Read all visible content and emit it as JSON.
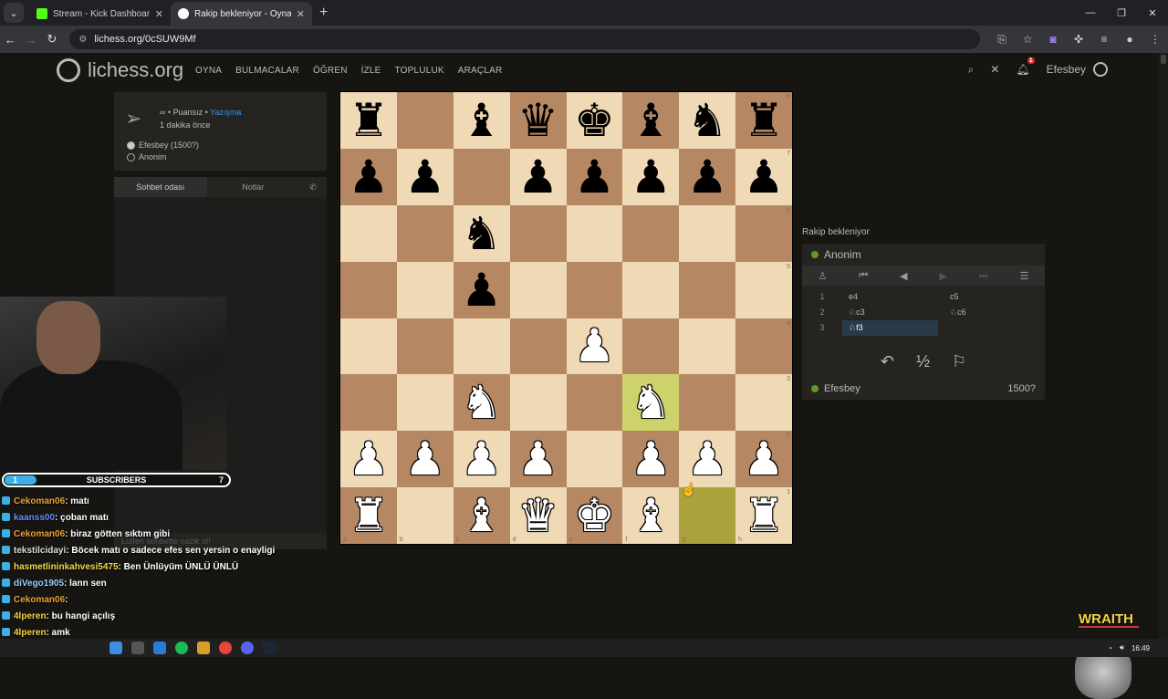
{
  "browser": {
    "tabs": [
      {
        "label": "Stream - Kick Dashboard",
        "color": "#53fc18"
      },
      {
        "label": "Rakip bekleniyor - Oyna An",
        "color": "#ffffff"
      }
    ],
    "url": "lichess.org/0cSUW9Mf"
  },
  "header": {
    "logo": "lichess.org",
    "menu": [
      "OYNA",
      "BULMACALAR",
      "ÖĞREN",
      "İZLE",
      "TOPLULUK",
      "ARAÇLAR"
    ],
    "notif_count": "1",
    "username": "Efesbey"
  },
  "game_info": {
    "mode_prefix": "∞ • Puansız •",
    "mode_link": "Yazışma",
    "time_ago": "1 dakika önce",
    "white_player": "Efesbey (1500?)",
    "black_player": "Anonim"
  },
  "chat": {
    "tab_room": "Sohbet odası",
    "tab_notes": "Notlar",
    "placeholder": "Lütfen sohbette nazik ol!"
  },
  "board": {
    "rows": [
      [
        "r",
        "",
        "b",
        "q",
        "k",
        "b",
        "n",
        "r"
      ],
      [
        "p",
        "p",
        "",
        "p",
        "p",
        "p",
        "p",
        "p"
      ],
      [
        "",
        "",
        "n",
        "",
        "",
        "",
        "",
        ""
      ],
      [
        "",
        "",
        "p",
        "",
        "",
        "",
        "",
        ""
      ],
      [
        "",
        "",
        "",
        "",
        "P",
        "",
        "",
        ""
      ],
      [
        "",
        "",
        "N",
        "",
        "",
        "N",
        "",
        ""
      ],
      [
        "P",
        "P",
        "P",
        "P",
        "",
        "P",
        "P",
        "P"
      ],
      [
        "R",
        "",
        "B",
        "Q",
        "K",
        "B",
        "",
        "R"
      ]
    ],
    "highlight": [
      [
        5,
        5
      ],
      [
        7,
        6
      ]
    ],
    "ranks": [
      "8",
      "7",
      "6",
      "5",
      "4",
      "3",
      "2",
      "1"
    ],
    "files": [
      "a",
      "b",
      "c",
      "d",
      "e",
      "f",
      "g",
      "h"
    ]
  },
  "side_panel": {
    "waiting": "Rakip bekleniyor",
    "top_player": "Anonim",
    "bottom_player": "Efesbey",
    "bottom_rating": "1500?",
    "moves": [
      {
        "n": "1",
        "w": "e4",
        "b": "c5"
      },
      {
        "n": "2",
        "w": "♘c3",
        "b": "♘c6"
      },
      {
        "n": "3",
        "w": "♘f3",
        "b": ""
      }
    ],
    "half_label": "½"
  },
  "stream": {
    "subs_current": "1",
    "subs_label": "SUBSCRIBERS",
    "subs_goal": "7",
    "subs_fraction": 0.14,
    "messages": [
      {
        "user": "Cekoman06",
        "text": ": matı",
        "color": "#f0a030"
      },
      {
        "user": "kaanss00",
        "text": ": çoban matı",
        "color": "#6a8cff"
      },
      {
        "user": "Cekoman06",
        "text": ": biraz götten sıktım gibi",
        "color": "#f0a030"
      },
      {
        "user": "tekstilcidayi",
        "text": ": Böcek matı o sadece efes sen yersin o enayligi",
        "color": "#dddddd"
      },
      {
        "user": "hasmetlininkahvesi5475",
        "text": ": Ben Ünlüyüm ÜNLÜ ÜNLÜ",
        "color": "#f5d742"
      },
      {
        "user": "diVego1905",
        "text": ": lann sen",
        "color": "#9ad0ff"
      },
      {
        "user": "Cekoman06",
        "text": ":",
        "color": "#f0a030"
      },
      {
        "user": "4lperen",
        "text": ": bu hangi açılış",
        "color": "#f5d742"
      },
      {
        "user": "4lperen",
        "text": ": amk",
        "color": "#f5d742"
      }
    ],
    "overlay_brand": "WRAITH"
  },
  "taskbar": {
    "time": "16:49"
  }
}
